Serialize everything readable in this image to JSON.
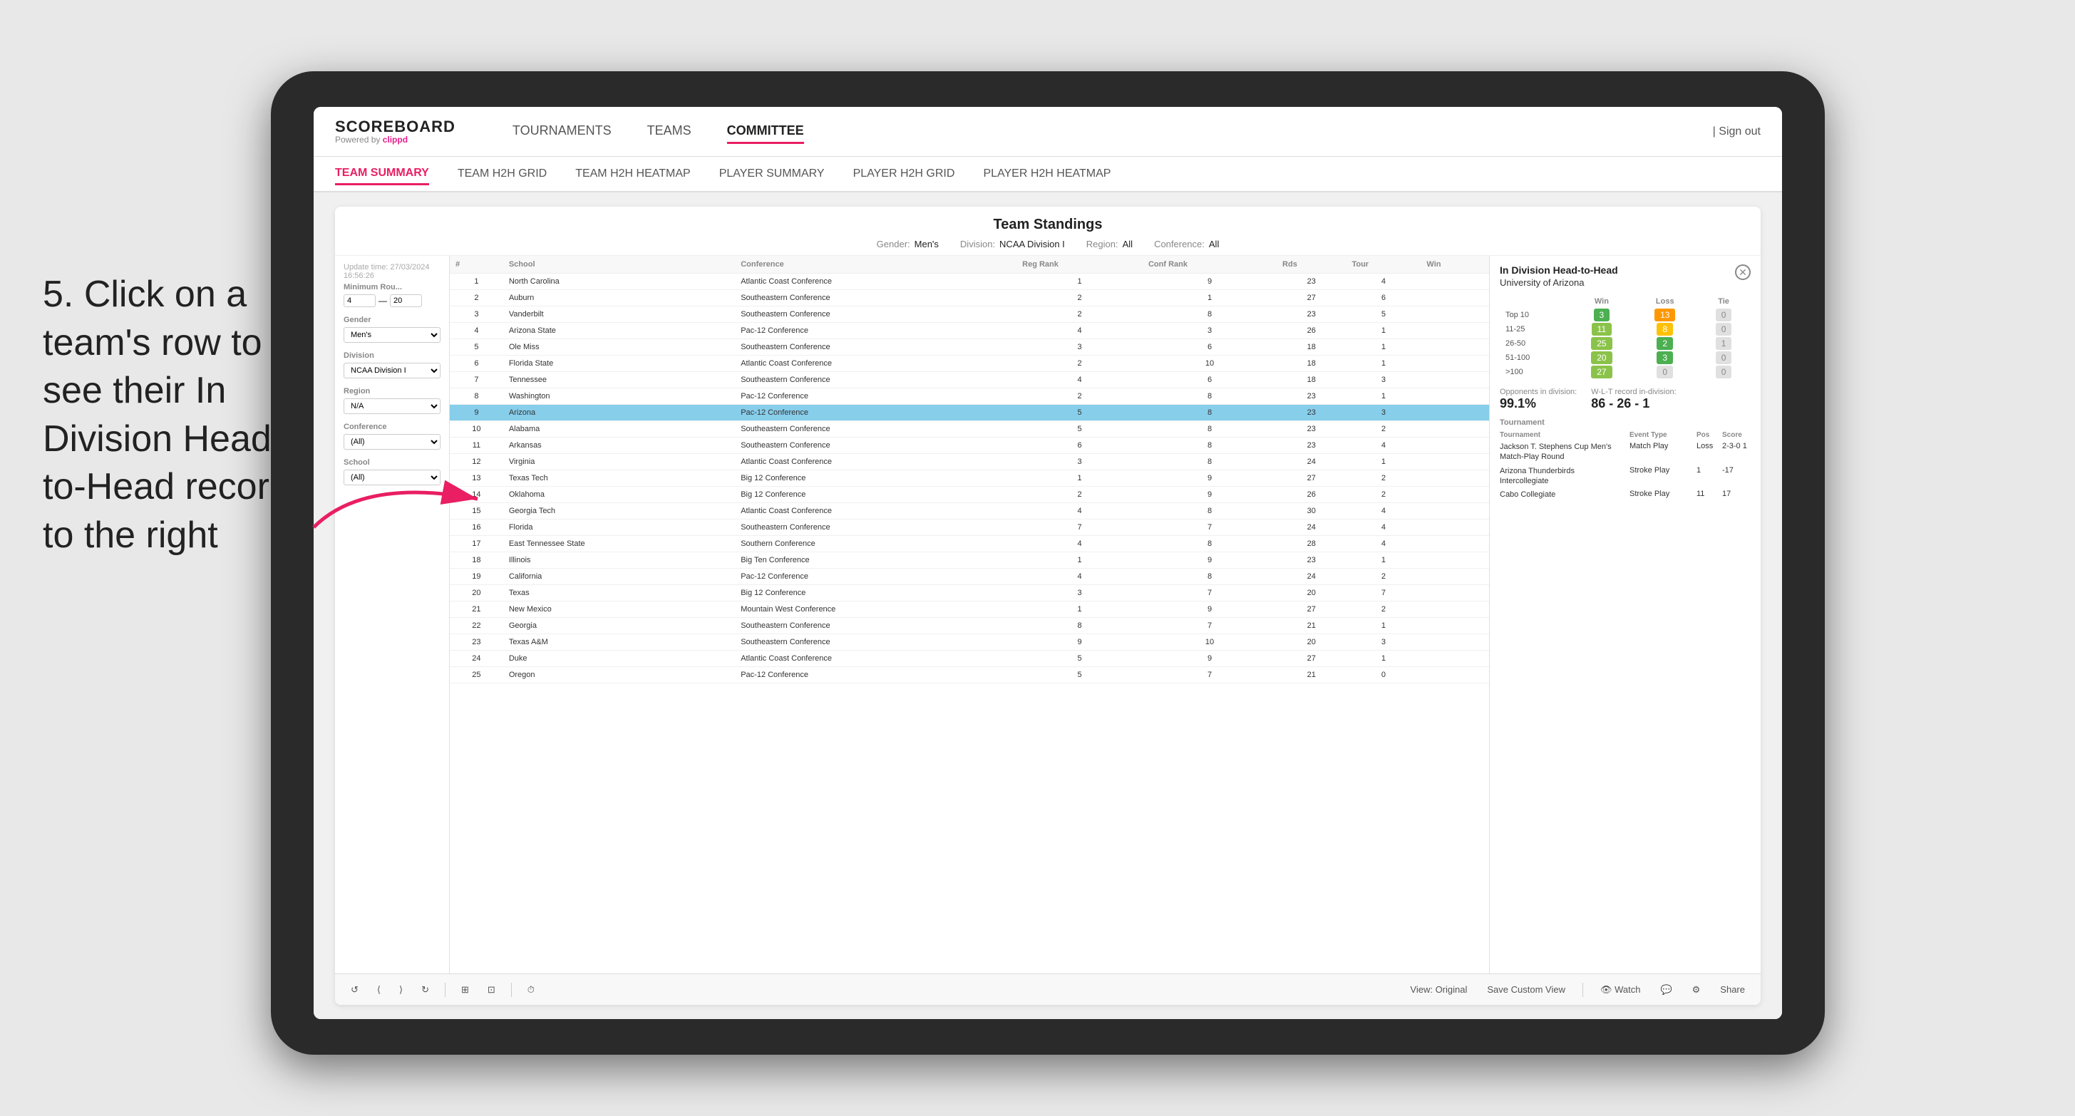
{
  "instruction": {
    "text": "5. Click on a team's row to see their In Division Head-to-Head record to the right"
  },
  "nav": {
    "logo": "SCOREBOARD",
    "logo_sub": "Powered by",
    "logo_brand": "clippd",
    "items": [
      "TOURNAMENTS",
      "TEAMS",
      "COMMITTEE"
    ],
    "active_nav": "COMMITTEE",
    "sign_out": "Sign out"
  },
  "sub_nav": {
    "items": [
      "TEAM SUMMARY",
      "TEAM H2H GRID",
      "TEAM H2H HEATMAP",
      "PLAYER SUMMARY",
      "PLAYER H2H GRID",
      "PLAYER H2H HEATMAP"
    ],
    "active": "PLAYER SUMMARY"
  },
  "update_time": "Update time: 27/03/2024 16:56:26",
  "page_title": "Team Standings",
  "filters": {
    "gender": "Men's",
    "division": "NCAA Division I",
    "region": "All",
    "conference": "All"
  },
  "left_filters": {
    "min_rounds_label": "Minimum Rou...",
    "min_rounds_val": "4",
    "min_rounds_max": "20",
    "gender_label": "Gender",
    "gender_val": "Men's",
    "division_label": "Division",
    "division_val": "NCAA Division I",
    "region_label": "Region",
    "region_val": "N/A",
    "conference_label": "Conference",
    "conference_val": "(All)",
    "school_label": "School",
    "school_val": "(All)"
  },
  "table": {
    "headers": [
      "#",
      "School",
      "Conference",
      "Reg Rank",
      "Conf Rank",
      "Rds",
      "Tour",
      "Win"
    ],
    "rows": [
      {
        "rank": 1,
        "school": "North Carolina",
        "conference": "Atlantic Coast Conference",
        "reg": 1,
        "conf": 9,
        "rds": 23,
        "tour": 4,
        "win": null,
        "highlighted": false
      },
      {
        "rank": 2,
        "school": "Auburn",
        "conference": "Southeastern Conference",
        "reg": 2,
        "conf": 1,
        "rds": 27,
        "tour": 6,
        "win": null,
        "highlighted": false
      },
      {
        "rank": 3,
        "school": "Vanderbilt",
        "conference": "Southeastern Conference",
        "reg": 2,
        "conf": 8,
        "rds": 23,
        "tour": 5,
        "win": null,
        "highlighted": false
      },
      {
        "rank": 4,
        "school": "Arizona State",
        "conference": "Pac-12 Conference",
        "reg": 4,
        "conf": 3,
        "rds": 26,
        "tour": 1,
        "win": null,
        "highlighted": false
      },
      {
        "rank": 5,
        "school": "Ole Miss",
        "conference": "Southeastern Conference",
        "reg": 3,
        "conf": 6,
        "rds": 18,
        "tour": 1,
        "win": null,
        "highlighted": false
      },
      {
        "rank": 6,
        "school": "Florida State",
        "conference": "Atlantic Coast Conference",
        "reg": 2,
        "conf": 10,
        "rds": 18,
        "tour": 1,
        "win": null,
        "highlighted": false
      },
      {
        "rank": 7,
        "school": "Tennessee",
        "conference": "Southeastern Conference",
        "reg": 4,
        "conf": 6,
        "rds": 18,
        "tour": 3,
        "win": null,
        "highlighted": false
      },
      {
        "rank": 8,
        "school": "Washington",
        "conference": "Pac-12 Conference",
        "reg": 2,
        "conf": 8,
        "rds": 23,
        "tour": 1,
        "win": null,
        "highlighted": false
      },
      {
        "rank": 9,
        "school": "Arizona",
        "conference": "Pac-12 Conference",
        "reg": 5,
        "conf": 8,
        "rds": 23,
        "tour": 3,
        "win": null,
        "highlighted": true
      },
      {
        "rank": 10,
        "school": "Alabama",
        "conference": "Southeastern Conference",
        "reg": 5,
        "conf": 8,
        "rds": 23,
        "tour": 2,
        "win": null,
        "highlighted": false
      },
      {
        "rank": 11,
        "school": "Arkansas",
        "conference": "Southeastern Conference",
        "reg": 6,
        "conf": 8,
        "rds": 23,
        "tour": 4,
        "win": null,
        "highlighted": false
      },
      {
        "rank": 12,
        "school": "Virginia",
        "conference": "Atlantic Coast Conference",
        "reg": 3,
        "conf": 8,
        "rds": 24,
        "tour": 1,
        "win": null,
        "highlighted": false
      },
      {
        "rank": 13,
        "school": "Texas Tech",
        "conference": "Big 12 Conference",
        "reg": 1,
        "conf": 9,
        "rds": 27,
        "tour": 2,
        "win": null,
        "highlighted": false
      },
      {
        "rank": 14,
        "school": "Oklahoma",
        "conference": "Big 12 Conference",
        "reg": 2,
        "conf": 9,
        "rds": 26,
        "tour": 2,
        "win": null,
        "highlighted": false
      },
      {
        "rank": 15,
        "school": "Georgia Tech",
        "conference": "Atlantic Coast Conference",
        "reg": 4,
        "conf": 8,
        "rds": 30,
        "tour": 4,
        "win": null,
        "highlighted": false
      },
      {
        "rank": 16,
        "school": "Florida",
        "conference": "Southeastern Conference",
        "reg": 7,
        "conf": 7,
        "rds": 24,
        "tour": 4,
        "win": null,
        "highlighted": false
      },
      {
        "rank": 17,
        "school": "East Tennessee State",
        "conference": "Southern Conference",
        "reg": 4,
        "conf": 8,
        "rds": 28,
        "tour": 4,
        "win": null,
        "highlighted": false
      },
      {
        "rank": 18,
        "school": "Illinois",
        "conference": "Big Ten Conference",
        "reg": 1,
        "conf": 9,
        "rds": 23,
        "tour": 1,
        "win": null,
        "highlighted": false
      },
      {
        "rank": 19,
        "school": "California",
        "conference": "Pac-12 Conference",
        "reg": 4,
        "conf": 8,
        "rds": 24,
        "tour": 2,
        "win": null,
        "highlighted": false
      },
      {
        "rank": 20,
        "school": "Texas",
        "conference": "Big 12 Conference",
        "reg": 3,
        "conf": 7,
        "rds": 20,
        "tour": 7,
        "win": null,
        "highlighted": false
      },
      {
        "rank": 21,
        "school": "New Mexico",
        "conference": "Mountain West Conference",
        "reg": 1,
        "conf": 9,
        "rds": 27,
        "tour": 2,
        "win": null,
        "highlighted": false
      },
      {
        "rank": 22,
        "school": "Georgia",
        "conference": "Southeastern Conference",
        "reg": 8,
        "conf": 7,
        "rds": 21,
        "tour": 1,
        "win": null,
        "highlighted": false
      },
      {
        "rank": 23,
        "school": "Texas A&M",
        "conference": "Southeastern Conference",
        "reg": 9,
        "conf": 10,
        "rds": 20,
        "tour": 3,
        "win": null,
        "highlighted": false
      },
      {
        "rank": 24,
        "school": "Duke",
        "conference": "Atlantic Coast Conference",
        "reg": 5,
        "conf": 9,
        "rds": 27,
        "tour": 1,
        "win": null,
        "highlighted": false
      },
      {
        "rank": 25,
        "school": "Oregon",
        "conference": "Pac-12 Conference",
        "reg": 5,
        "conf": 7,
        "rds": 21,
        "tour": 0,
        "win": null,
        "highlighted": false
      }
    ]
  },
  "h2h": {
    "title": "In Division Head-to-Head",
    "subtitle": "University of Arizona",
    "headers": [
      "Win",
      "Loss",
      "Tie"
    ],
    "rows": [
      {
        "label": "Top 10",
        "win": 3,
        "loss": 13,
        "tie": 0,
        "win_color": "green",
        "loss_color": "orange",
        "tie_color": "gray"
      },
      {
        "label": "11-25",
        "win": 11,
        "loss": 8,
        "tie": 0,
        "win_color": "lightgreen",
        "loss_color": "amber",
        "tie_color": "gray"
      },
      {
        "label": "26-50",
        "win": 25,
        "loss": 2,
        "tie": 1,
        "win_color": "lightgreen",
        "loss_color": "green",
        "tie_color": "gray"
      },
      {
        "label": "51-100",
        "win": 20,
        "loss": 3,
        "tie": 0,
        "win_color": "lightgreen",
        "loss_color": "green",
        "tie_color": "gray"
      },
      {
        "label": ">100",
        "win": 27,
        "loss": 0,
        "tie": 0,
        "win_color": "lightgreen",
        "loss_color": "gray",
        "tie_color": "gray"
      }
    ],
    "opponents_label": "Opponents in division:",
    "opponents_value": "99.1%",
    "wlt_label": "W-L-T record in-division:",
    "wlt_value": "86 - 26 - 1",
    "tournaments_title": "Tournament",
    "tournaments_headers": [
      "Tournament",
      "Event Type",
      "Pos",
      "Score"
    ],
    "tournaments": [
      {
        "name": "Jackson T. Stephens Cup Men's Match-Play Round",
        "event": "Match Play",
        "pos": "Loss",
        "score": "2-3-0 1"
      },
      {
        "name": "Arizona Thunderbirds Intercollegiate",
        "event": "Stroke Play",
        "pos": "1",
        "score": "-17"
      },
      {
        "name": "Cabo Collegiate",
        "event": "Stroke Play",
        "pos": "11",
        "score": "17"
      }
    ]
  },
  "toolbar": {
    "undo": "↺",
    "redo": "↻",
    "view_original": "View: Original",
    "save_custom": "Save Custom View",
    "watch": "Watch",
    "share": "Share"
  }
}
